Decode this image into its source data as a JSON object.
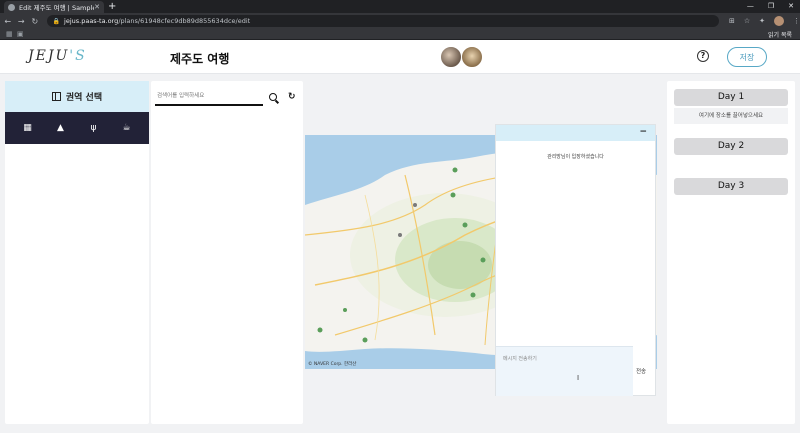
{
  "browser": {
    "tab_title": "Edit 제주도 여행 | Sample",
    "url_host": "jejus.paas-ta.org",
    "url_path": "/plans/61948cfec9db89d855634dce/edit",
    "bookmark_reading_list": "읽기 목록"
  },
  "header": {
    "logo": "JEJU",
    "logo_accent": "'S",
    "plan_title": "제주도 여행",
    "help_label": "?",
    "save_label": "저장"
  },
  "region_panel": {
    "title": "권역 선택",
    "categories": [
      "grid-icon",
      "mountain-icon",
      "restaurant-icon",
      "cafe-icon"
    ]
  },
  "search_panel": {
    "placeholder": "검색어를 입력하세요"
  },
  "map": {
    "credit": "© NAVER Corp. 한라산"
  },
  "chat": {
    "notice": "관리방님이 입장하셨습니다",
    "placeholder": "메시지 전송하기",
    "send_label": "전송"
  },
  "days": {
    "day1": "Day 1",
    "drop_hint": "여기에 장소를 끌어넣으세요",
    "day2": "Day 2",
    "day3": "Day 3"
  },
  "colors": {
    "accent": "#d7eef8",
    "dark_bar": "#222237",
    "save_border": "#58a8c6"
  }
}
